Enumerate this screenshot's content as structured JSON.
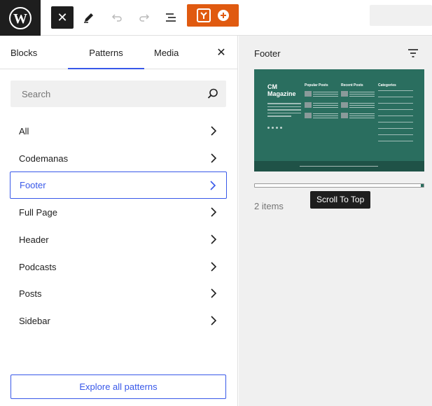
{
  "topbar": {
    "close_symbol": "✕"
  },
  "tabs": {
    "blocks": "Blocks",
    "patterns": "Patterns",
    "media": "Media",
    "close_symbol": "✕"
  },
  "search": {
    "placeholder": "Search"
  },
  "categories": [
    {
      "label": "All",
      "active": false
    },
    {
      "label": "Codemanas",
      "active": false
    },
    {
      "label": "Footer",
      "active": true
    },
    {
      "label": "Full Page",
      "active": false
    },
    {
      "label": "Header",
      "active": false
    },
    {
      "label": "Podcasts",
      "active": false
    },
    {
      "label": "Posts",
      "active": false
    },
    {
      "label": "Sidebar",
      "active": false
    }
  ],
  "explore_label": "Explore all patterns",
  "right_panel": {
    "title": "Footer",
    "tooltip": "Scroll To Top",
    "count": "2 items",
    "preview": {
      "brand": "CM Magazine",
      "col_popular": "Popular Posts",
      "col_recent": "Recent Posts",
      "col_categories": "Categories"
    }
  },
  "colors": {
    "accent": "#3858e9",
    "orange": "#e05a10",
    "preview_bg": "#2a6e5f"
  }
}
